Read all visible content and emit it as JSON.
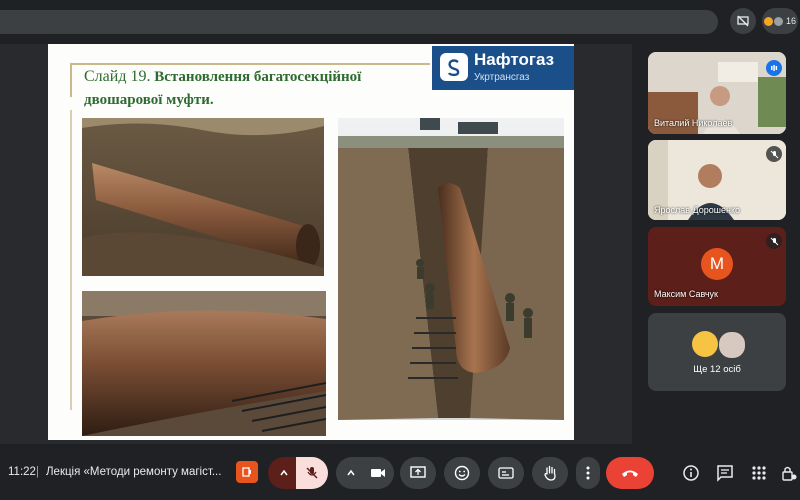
{
  "topbar": {
    "people_count": "16"
  },
  "slide": {
    "title_number": "Слайд 19.",
    "title_text": "Встановлення багатосекційної двошарової муфти.",
    "logo_name": "Нафтогаз",
    "logo_sub": "Укртрансгаз"
  },
  "participants": [
    {
      "name": "Виталий Николаев"
    },
    {
      "name": "Ярослав Дорошенко"
    },
    {
      "name": "Максим Савчук",
      "initial": "M"
    },
    {
      "name": "Ще 12 осіб"
    }
  ],
  "meeting": {
    "time": "11:22",
    "separator": "|",
    "title": "Лекція «Методи ремонту магіст..."
  },
  "colors": {
    "accent_red": "#ea4335",
    "avatar_orange": "#e8541e",
    "slide_green": "#2d6b30"
  }
}
